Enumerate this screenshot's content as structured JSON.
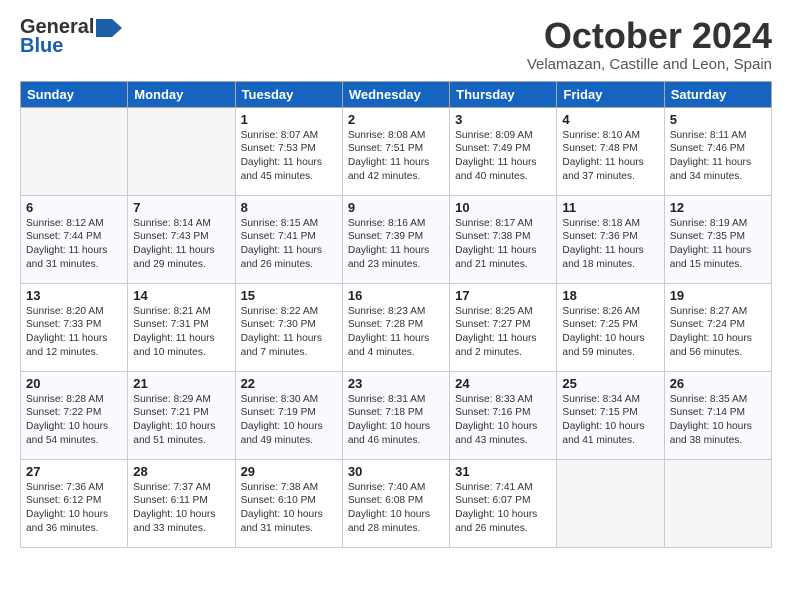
{
  "logo": {
    "line1": "General",
    "line2": "Blue"
  },
  "title": "October 2024",
  "location": "Velamazan, Castille and Leon, Spain",
  "days_of_week": [
    "Sunday",
    "Monday",
    "Tuesday",
    "Wednesday",
    "Thursday",
    "Friday",
    "Saturday"
  ],
  "weeks": [
    [
      {
        "day": "",
        "text": ""
      },
      {
        "day": "",
        "text": ""
      },
      {
        "day": "1",
        "text": "Sunrise: 8:07 AM\nSunset: 7:53 PM\nDaylight: 11 hours and 45 minutes."
      },
      {
        "day": "2",
        "text": "Sunrise: 8:08 AM\nSunset: 7:51 PM\nDaylight: 11 hours and 42 minutes."
      },
      {
        "day": "3",
        "text": "Sunrise: 8:09 AM\nSunset: 7:49 PM\nDaylight: 11 hours and 40 minutes."
      },
      {
        "day": "4",
        "text": "Sunrise: 8:10 AM\nSunset: 7:48 PM\nDaylight: 11 hours and 37 minutes."
      },
      {
        "day": "5",
        "text": "Sunrise: 8:11 AM\nSunset: 7:46 PM\nDaylight: 11 hours and 34 minutes."
      }
    ],
    [
      {
        "day": "6",
        "text": "Sunrise: 8:12 AM\nSunset: 7:44 PM\nDaylight: 11 hours and 31 minutes."
      },
      {
        "day": "7",
        "text": "Sunrise: 8:14 AM\nSunset: 7:43 PM\nDaylight: 11 hours and 29 minutes."
      },
      {
        "day": "8",
        "text": "Sunrise: 8:15 AM\nSunset: 7:41 PM\nDaylight: 11 hours and 26 minutes."
      },
      {
        "day": "9",
        "text": "Sunrise: 8:16 AM\nSunset: 7:39 PM\nDaylight: 11 hours and 23 minutes."
      },
      {
        "day": "10",
        "text": "Sunrise: 8:17 AM\nSunset: 7:38 PM\nDaylight: 11 hours and 21 minutes."
      },
      {
        "day": "11",
        "text": "Sunrise: 8:18 AM\nSunset: 7:36 PM\nDaylight: 11 hours and 18 minutes."
      },
      {
        "day": "12",
        "text": "Sunrise: 8:19 AM\nSunset: 7:35 PM\nDaylight: 11 hours and 15 minutes."
      }
    ],
    [
      {
        "day": "13",
        "text": "Sunrise: 8:20 AM\nSunset: 7:33 PM\nDaylight: 11 hours and 12 minutes."
      },
      {
        "day": "14",
        "text": "Sunrise: 8:21 AM\nSunset: 7:31 PM\nDaylight: 11 hours and 10 minutes."
      },
      {
        "day": "15",
        "text": "Sunrise: 8:22 AM\nSunset: 7:30 PM\nDaylight: 11 hours and 7 minutes."
      },
      {
        "day": "16",
        "text": "Sunrise: 8:23 AM\nSunset: 7:28 PM\nDaylight: 11 hours and 4 minutes."
      },
      {
        "day": "17",
        "text": "Sunrise: 8:25 AM\nSunset: 7:27 PM\nDaylight: 11 hours and 2 minutes."
      },
      {
        "day": "18",
        "text": "Sunrise: 8:26 AM\nSunset: 7:25 PM\nDaylight: 10 hours and 59 minutes."
      },
      {
        "day": "19",
        "text": "Sunrise: 8:27 AM\nSunset: 7:24 PM\nDaylight: 10 hours and 56 minutes."
      }
    ],
    [
      {
        "day": "20",
        "text": "Sunrise: 8:28 AM\nSunset: 7:22 PM\nDaylight: 10 hours and 54 minutes."
      },
      {
        "day": "21",
        "text": "Sunrise: 8:29 AM\nSunset: 7:21 PM\nDaylight: 10 hours and 51 minutes."
      },
      {
        "day": "22",
        "text": "Sunrise: 8:30 AM\nSunset: 7:19 PM\nDaylight: 10 hours and 49 minutes."
      },
      {
        "day": "23",
        "text": "Sunrise: 8:31 AM\nSunset: 7:18 PM\nDaylight: 10 hours and 46 minutes."
      },
      {
        "day": "24",
        "text": "Sunrise: 8:33 AM\nSunset: 7:16 PM\nDaylight: 10 hours and 43 minutes."
      },
      {
        "day": "25",
        "text": "Sunrise: 8:34 AM\nSunset: 7:15 PM\nDaylight: 10 hours and 41 minutes."
      },
      {
        "day": "26",
        "text": "Sunrise: 8:35 AM\nSunset: 7:14 PM\nDaylight: 10 hours and 38 minutes."
      }
    ],
    [
      {
        "day": "27",
        "text": "Sunrise: 7:36 AM\nSunset: 6:12 PM\nDaylight: 10 hours and 36 minutes."
      },
      {
        "day": "28",
        "text": "Sunrise: 7:37 AM\nSunset: 6:11 PM\nDaylight: 10 hours and 33 minutes."
      },
      {
        "day": "29",
        "text": "Sunrise: 7:38 AM\nSunset: 6:10 PM\nDaylight: 10 hours and 31 minutes."
      },
      {
        "day": "30",
        "text": "Sunrise: 7:40 AM\nSunset: 6:08 PM\nDaylight: 10 hours and 28 minutes."
      },
      {
        "day": "31",
        "text": "Sunrise: 7:41 AM\nSunset: 6:07 PM\nDaylight: 10 hours and 26 minutes."
      },
      {
        "day": "",
        "text": ""
      },
      {
        "day": "",
        "text": ""
      }
    ]
  ]
}
